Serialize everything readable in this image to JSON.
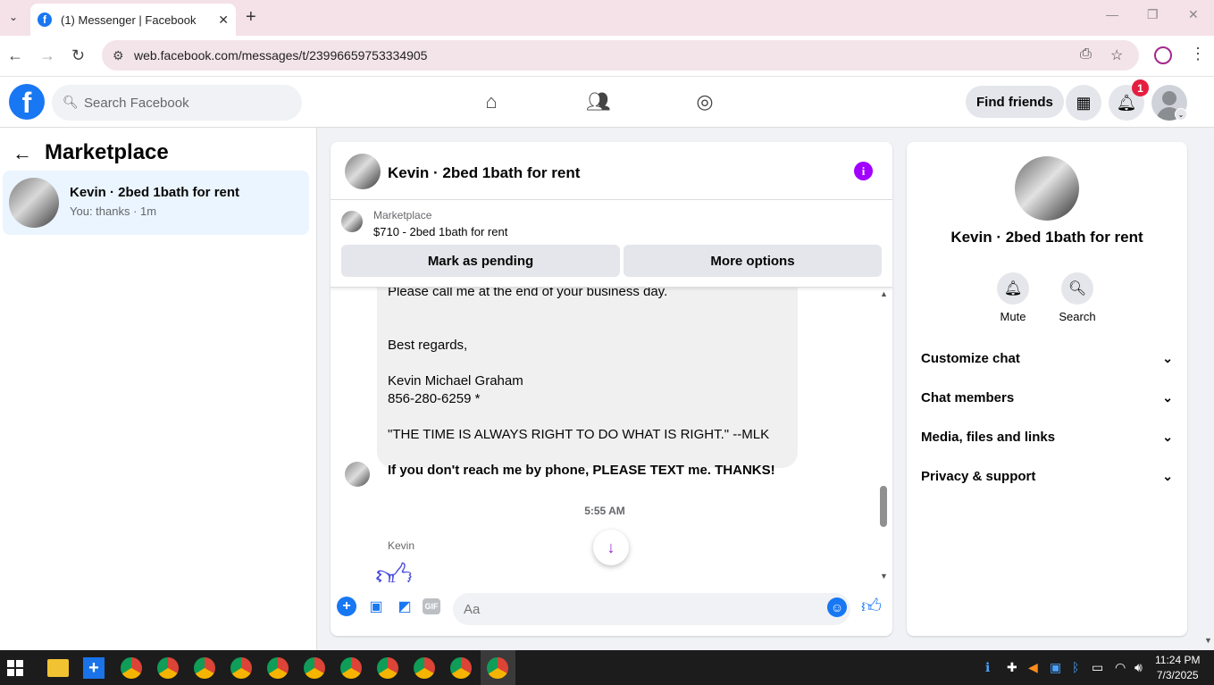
{
  "browser": {
    "tab_title": "(1) Messenger | Facebook",
    "url": "web.facebook.com/messages/t/23996659753334905"
  },
  "fb": {
    "search_placeholder": "Search Facebook",
    "find_friends": "Find friends",
    "notification_count": "1"
  },
  "sidebar": {
    "title": "Marketplace",
    "conversation": {
      "name": "Kevin · 2bed 1bath for rent",
      "snippet": "You: thanks · 1m"
    }
  },
  "chat": {
    "name": "Kevin · 2bed 1bath for rent",
    "listing": {
      "category": "Marketplace",
      "price_title": "$710 - 2bed 1bath for rent",
      "mark_pending": "Mark as pending",
      "more_options": "More options"
    },
    "message_lines": [
      "Please call me at the end of your business day.",
      "Best regards,",
      "Kevin Michael Graham",
      "856-280-6259 *",
      "\"THE TIME IS ALWAYS RIGHT TO DO WHAT IS RIGHT.\"  --MLK",
      "If you don't reach me by phone, PLEASE TEXT me.  THANKS!"
    ],
    "timestamp": "5:55 AM",
    "sender": "Kevin",
    "input_placeholder": "Aa"
  },
  "right_panel": {
    "name": "Kevin · 2bed 1bath for rent",
    "actions": [
      {
        "label": "Mute",
        "icon": "bell-icon"
      },
      {
        "label": "Search",
        "icon": "search-icon"
      }
    ],
    "sections": [
      "Customize chat",
      "Chat members",
      "Media, files and links",
      "Privacy & support"
    ]
  },
  "taskbar": {
    "time": "11:24 PM",
    "date": "7/3/2025"
  },
  "colors": {
    "fb_blue": "#1877f2",
    "messenger_purple": "#a100ff",
    "selected_conversation": "#ebf5ff",
    "notification_red": "#e41e3f"
  }
}
